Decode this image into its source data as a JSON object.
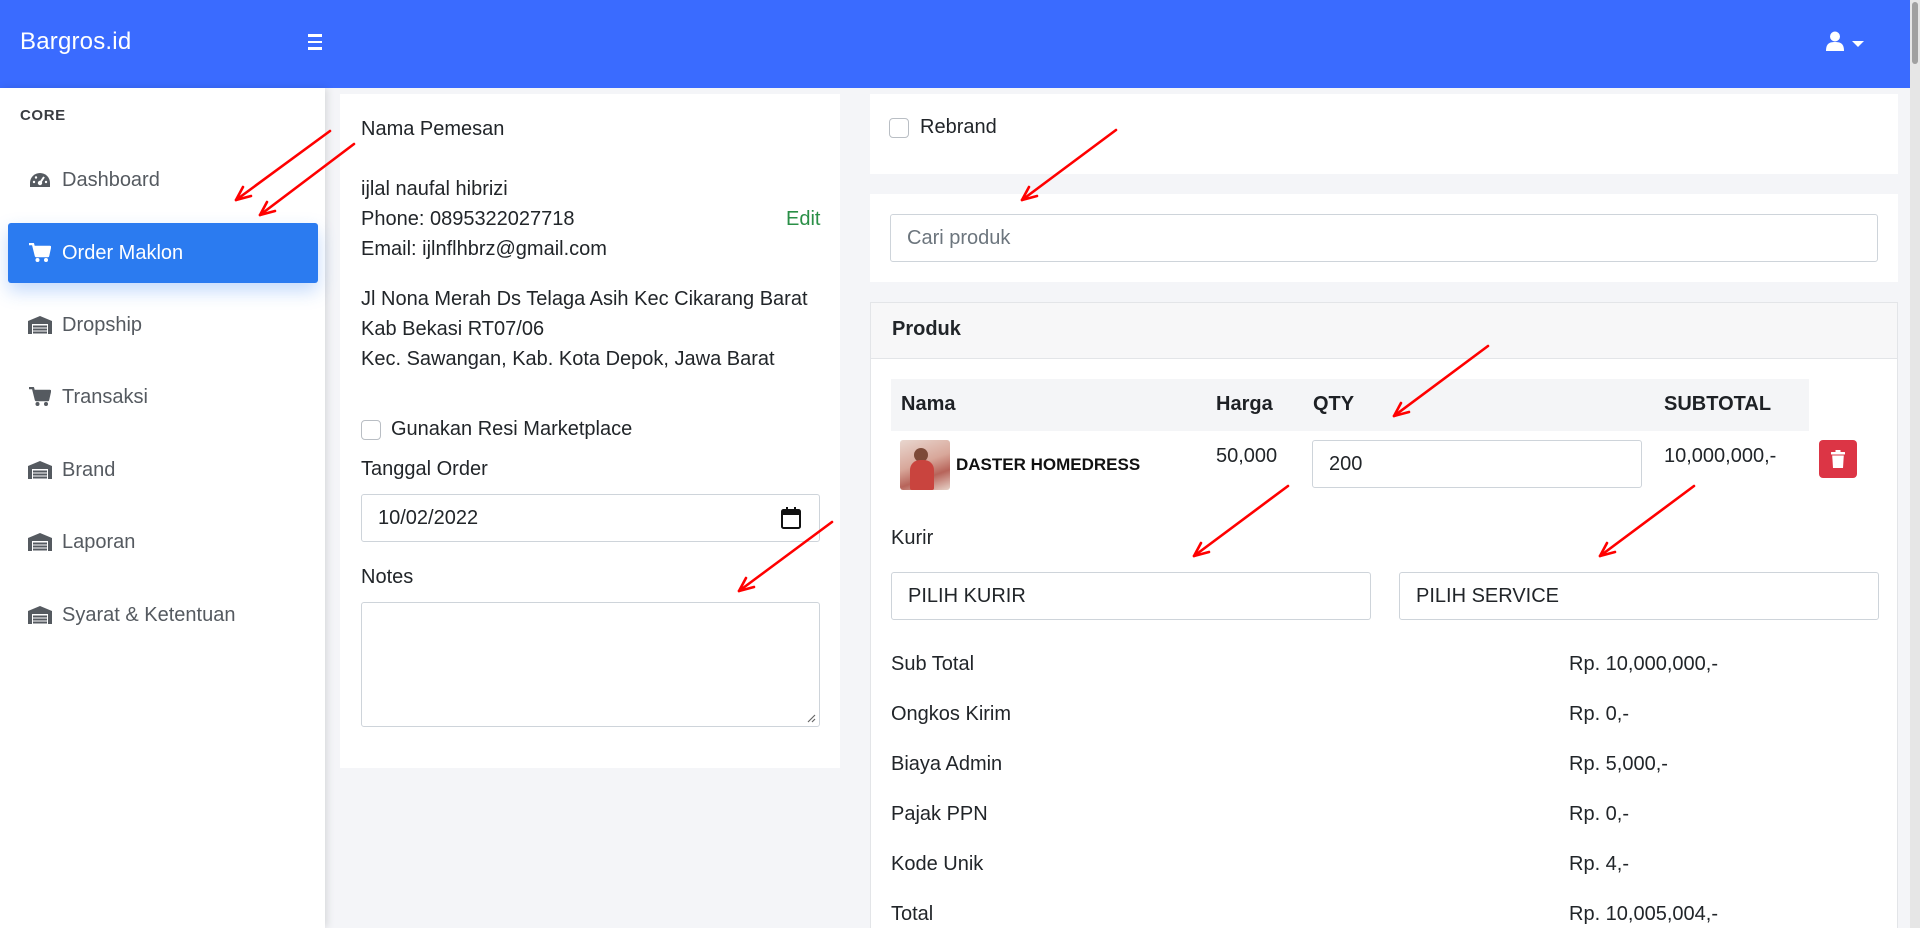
{
  "app": {
    "brand": "Bargros.id"
  },
  "topbar": {
    "menu_icon": "hamburger-icon",
    "user_icon": "user-icon"
  },
  "sidebar": {
    "heading": "CORE",
    "items": [
      {
        "label": "Dashboard",
        "icon": "gauge-icon"
      },
      {
        "label": "Order Maklon",
        "icon": "cart-icon",
        "active": true
      },
      {
        "label": "Dropship",
        "icon": "warehouse-icon"
      },
      {
        "label": "Transaksi",
        "icon": "cart-icon"
      },
      {
        "label": "Brand",
        "icon": "warehouse-icon"
      },
      {
        "label": "Laporan",
        "icon": "warehouse-icon"
      },
      {
        "label": "Syarat & Ketentuan",
        "icon": "warehouse-icon"
      }
    ]
  },
  "customer": {
    "heading": "Nama Pemesan",
    "name": "ijlal naufal hibrizi",
    "phone": "Phone: 0895322027718",
    "edit_label": "Edit",
    "email": "Email: ijlnflhbrz@gmail.com",
    "address_line1": "Jl Nona Merah Ds Telaga Asih Kec Cikarang Barat",
    "address_line2": "Kab Bekasi RT07/06",
    "address_line3": "Kec. Sawangan, Kab. Kota Depok, Jawa Barat"
  },
  "order_form": {
    "resi_label": "Gunakan Resi Marketplace",
    "date_label": "Tanggal Order",
    "date_value": "10/02/2022",
    "notes_label": "Notes",
    "notes_value": ""
  },
  "rebrand": {
    "label": "Rebrand",
    "checked": false
  },
  "search": {
    "placeholder": "Cari produk",
    "value": ""
  },
  "produk": {
    "title": "Produk",
    "columns": [
      "Nama",
      "Harga",
      "QTY",
      "SUBTOTAL"
    ],
    "rows": [
      {
        "name": "DASTER HOMEDRESS",
        "price": "50,000",
        "qty": "200",
        "subtotal": "10,000,000,-"
      }
    ],
    "kurir_label": "Kurir",
    "kurir_select": "PILIH KURIR",
    "service_select": "PILIH SERVICE",
    "summary": [
      {
        "label": "Sub Total",
        "value": "Rp. 10,000,000,-"
      },
      {
        "label": "Ongkos Kirim",
        "value": "Rp. 0,-"
      },
      {
        "label": "Biaya Admin",
        "value": "Rp. 5,000,-"
      },
      {
        "label": "Pajak PPN",
        "value": "Rp. 0,-"
      },
      {
        "label": "Kode Unik",
        "value": "Rp. 4,-"
      },
      {
        "label": "Total",
        "value": "Rp. 10,005,004,-"
      }
    ]
  },
  "colors": {
    "topbar": "#3a6bff",
    "active_nav": "#2b7bf0",
    "edit_link": "#2a8f47",
    "delete": "#dc3545",
    "annotation": "#ff0000"
  }
}
